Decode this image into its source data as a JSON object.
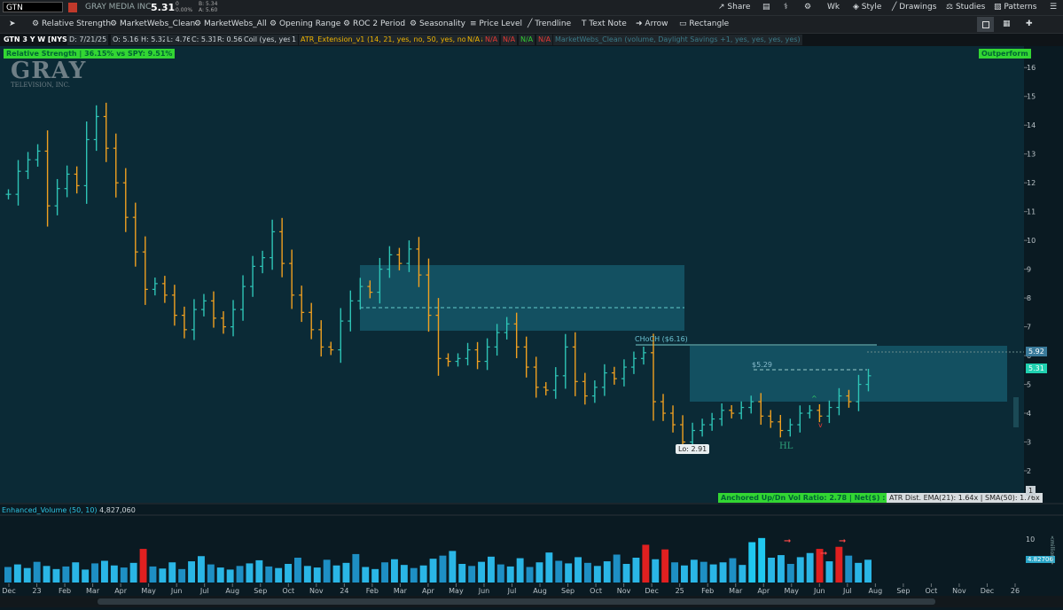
{
  "header": {
    "symbol": "GTN",
    "company": "GRAY MEDIA INC",
    "last": "5.31",
    "change": "0",
    "change_pct": "0.00%",
    "bid": "B: 5.34",
    "ask": "A: 5.60",
    "buttons": [
      "Share",
      "Wk",
      "Style",
      "Drawings",
      "Studies",
      "Patterns"
    ]
  },
  "toolbar": {
    "items": [
      "Relative Strength",
      "MarketWebs_Clean",
      "MarketWebs_All",
      "Opening Range",
      "ROC 2 Period",
      "Seasonality",
      "Price Level",
      "Trendline",
      "Text Note",
      "Arrow",
      "Rectangle"
    ]
  },
  "study_line": {
    "title": "GTN 3 Y W [NYSE]",
    "date": "D: 7/21/25",
    "open": "O: 5.16",
    "high": "H: 5.32",
    "low": "L: 4.76",
    "close": "C: 5.31",
    "range": "R: 0.56",
    "coil": "Coil (yes, yes)",
    "one": "1",
    "atr": "ATR_Extension_v1 (14, 21, yes, no, 50, yes, no, yes)",
    "na": "N/A",
    "mw": "MarketWebs_Clean (volume, Daylight Savings +1, yes, yes, yes, yes)"
  },
  "overlays": {
    "rs": "Relative Strength | 36.15% vs SPY: 9.51%",
    "outperform": "Outperform",
    "logo_big": "GRAY",
    "logo_small": "TELEVISION, INC.",
    "choch": "CHoCH ($6.16)",
    "level": "$5.29",
    "hl": "HL",
    "lo": "Lo: 2.91",
    "avr": "Anchored Up/Dn Vol Ratio: 2.78 | Net($) : 16.60M",
    "atrdist": "ATR Dist. EMA(21): 1.64x | SMA(50): 1.76x",
    "price_tag_1": "5.92",
    "price_tag_2": "5.31",
    "one_tag": "1"
  },
  "volume": {
    "label": "Enhanced_Volume (50, 10)",
    "value": "4,827,060",
    "tag": "4.82706",
    "unit": "<millions>",
    "yticks": [
      "10",
      "5"
    ]
  },
  "chart_data": {
    "type": "bar",
    "title": "GTN 3 Y W [NYSE]",
    "xlabel": "",
    "ylabel": "",
    "ylim": [
      1.2,
      16.5
    ],
    "yticks": [
      2,
      3,
      4,
      5,
      6,
      7,
      8,
      9,
      10,
      11,
      12,
      13,
      14,
      15,
      16
    ],
    "xticks": [
      "Dec",
      "23",
      "Feb",
      "Mar",
      "Apr",
      "May",
      "Jun",
      "Jul",
      "Aug",
      "Sep",
      "Oct",
      "Nov",
      "24",
      "Feb",
      "Mar",
      "Apr",
      "May",
      "Jun",
      "Jul",
      "Aug",
      "Sep",
      "Oct",
      "Nov",
      "Dec",
      "25",
      "Feb",
      "Mar",
      "Apr",
      "May",
      "Jun",
      "Jul",
      "Aug",
      "Sep",
      "Oct",
      "Nov",
      "Dec",
      "26"
    ],
    "series": [
      {
        "values": [
          11.6,
          12.4,
          12.8,
          13.1,
          11.2,
          11.8,
          12.3,
          11.9,
          13.5,
          14.3,
          13.2,
          12.0,
          10.8,
          9.6,
          8.3,
          8.5,
          8.1,
          7.4,
          6.9,
          7.6,
          7.9,
          7.3,
          7.0,
          7.6,
          8.4,
          9.1,
          9.4,
          10.3,
          9.2,
          8.1,
          7.5,
          6.9,
          6.3,
          6.2,
          7.2,
          7.9,
          8.4,
          8.2,
          9.0,
          9.5,
          9.2,
          9.7,
          8.8,
          7.4,
          5.9,
          5.8,
          5.9,
          6.2,
          5.8,
          6.3,
          6.8,
          7.1,
          6.3,
          5.6,
          4.9,
          4.8,
          5.3,
          6.3,
          5.1,
          4.6,
          4.9,
          5.4,
          5.2,
          5.6,
          5.9,
          6.1,
          4.4,
          4.0,
          3.6,
          3.0,
          3.4,
          3.6,
          3.8,
          4.1,
          4.0,
          4.2,
          4.4,
          3.9,
          3.7,
          3.4,
          3.6,
          4.0,
          4.1,
          3.9,
          4.2,
          4.6,
          4.4,
          5.0,
          5.3
        ]
      }
    ],
    "volume": {
      "values": [
        3,
        3.5,
        2.8,
        4,
        3.2,
        2.6,
        3.1,
        3.9,
        2.5,
        3.7,
        4.2,
        3.3,
        2.9,
        3.8,
        6.5,
        3.1,
        2.7,
        3.9,
        2.6,
        4.1,
        5.1,
        3.5,
        2.9,
        2.5,
        3.2,
        3.7,
        4.3,
        3.1,
        2.8,
        3.6,
        4.8,
        3.2,
        2.9,
        4.4,
        3.3,
        3.8,
        5.5,
        3.0,
        2.6,
        3.9,
        4.5,
        3.4,
        2.8,
        3.3,
        4.6,
        5.2,
        6.1,
        3.6,
        3.2,
        4.0,
        5.0,
        3.5,
        3.1,
        4.7,
        3.0,
        3.9,
        5.8,
        4.2,
        3.7,
        4.9,
        3.8,
        3.2,
        4.1,
        5.4,
        3.6,
        4.8,
        7.3,
        4.5,
        6.4,
        3.9,
        3.3,
        4.4,
        4.0,
        3.5,
        3.9,
        4.7,
        3.4,
        7.8,
        8.6,
        4.8,
        5.3,
        3.6,
        4.9,
        5.7,
        6.5,
        4.1,
        6.9,
        5.2,
        3.8,
        4.4
      ]
    }
  }
}
